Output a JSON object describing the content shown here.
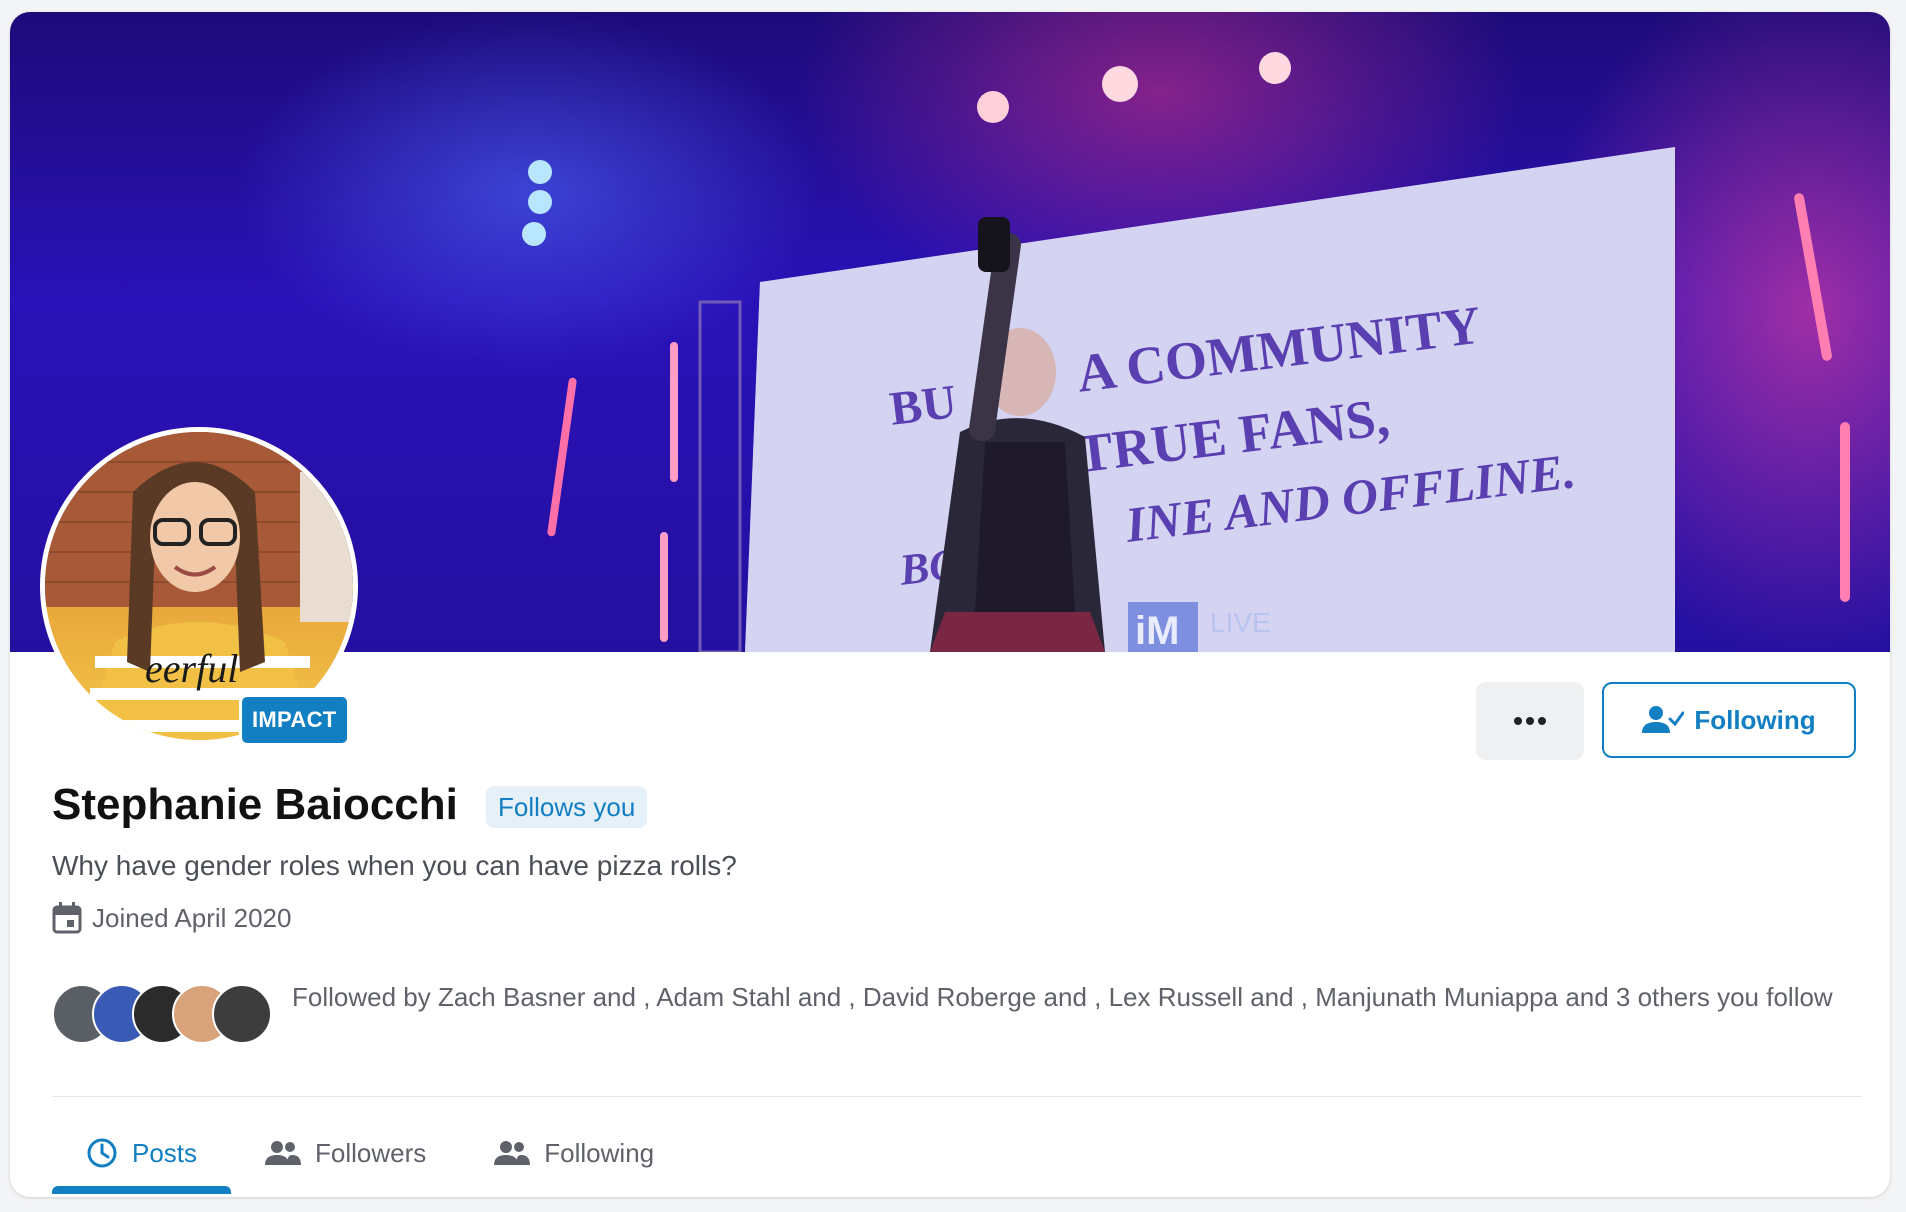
{
  "profile": {
    "name": "Stephanie Baiocchi",
    "follows_you_label": "Follows you",
    "badge": "IMPACT",
    "bio": "Why have gender roles when you can have pizza rolls?",
    "joined": "Joined April 2020"
  },
  "cover": {
    "screen_text": [
      "BU",
      "A COMMUNITY",
      "TRUE FANS,",
      "BO",
      "INE AND OFFLINE."
    ],
    "logo_text": "iM",
    "logo_sub": "LIVE",
    "shirt_text": "eerful"
  },
  "actions": {
    "more_icon": "ellipsis-icon",
    "following_label": "Following",
    "following_icon": "user-check-icon"
  },
  "mutuals": {
    "text": "Followed by Zach Basner and , Adam Stahl and , David Roberge and , Lex Russell and , Manjunath Muniappa and 3 others you follow",
    "avatar_colors": [
      "#5a5f66",
      "#3a5bb5",
      "#2b2b2b",
      "#d8a27a",
      "#3d3d3d"
    ]
  },
  "tabs": [
    {
      "label": "Posts",
      "icon": "clock-icon",
      "active": true
    },
    {
      "label": "Followers",
      "icon": "people-icon",
      "active": false
    },
    {
      "label": "Following",
      "icon": "people-icon",
      "active": false
    }
  ],
  "colors": {
    "accent": "#127fc3",
    "pill_bg": "#e6f0f9"
  }
}
